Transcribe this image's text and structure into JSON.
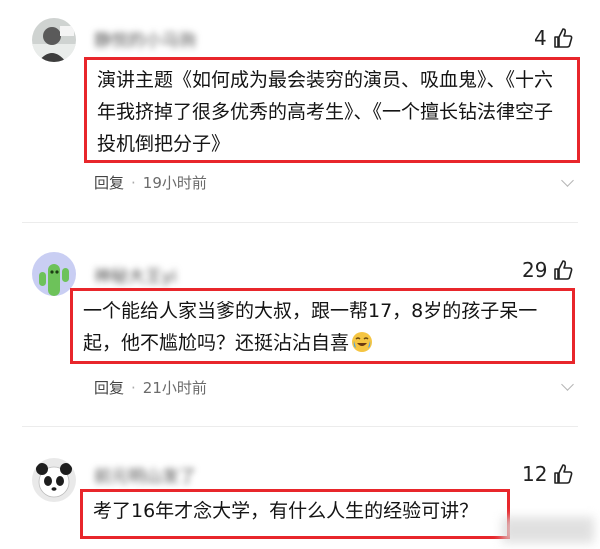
{
  "comments": [
    {
      "username": "静悦的小马驹",
      "likes": "4",
      "text": "演讲主题《如何成为最会装穷的演员、吸血鬼》、《十六年我挤掉了很多优秀的高考生》、《一个擅长钻法律空子投机倒把分子》",
      "reply_label": "回复",
      "time": "19小时前",
      "avatar_icon": "person-photo-avatar-icon"
    },
    {
      "username": "神秘大王yi",
      "likes": "29",
      "text": "一个能给人家当爹的大叔，跟一帮17，8岁的孩子呆一起，他不尴尬吗？还挺沾沾自喜",
      "reply_label": "回复",
      "time": "21小时前",
      "avatar_icon": "green-cactus-avatar-icon",
      "emoji_icon": "crying-laughing-emoji-icon"
    },
    {
      "username": "前元明山发了",
      "likes": "12",
      "text": "考了16年才念大学，有什么人生的经验可讲？",
      "avatar_icon": "panda-avatar-icon"
    }
  ],
  "colors": {
    "highlight_border": "#e8262b",
    "meta_text": "#6b6b6b"
  }
}
